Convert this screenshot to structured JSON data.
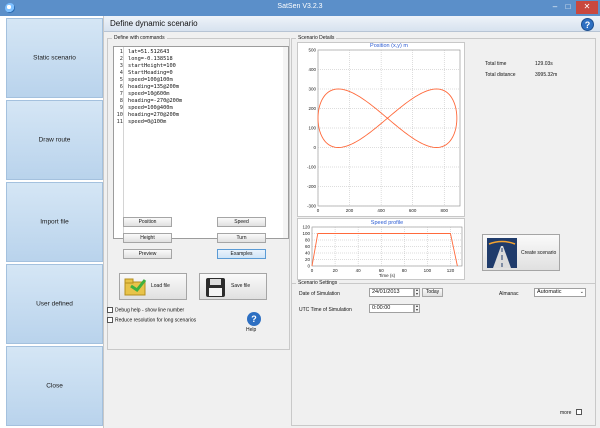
{
  "window": {
    "title": "SatSen V3.2.3",
    "minimize": "–",
    "maximize": "□",
    "close": "✕"
  },
  "sidebar": {
    "items": [
      {
        "label": "Static scenario"
      },
      {
        "label": "Draw route"
      },
      {
        "label": "Import file"
      },
      {
        "label": "User defined"
      },
      {
        "label": "Close"
      }
    ]
  },
  "header": {
    "title": "Define dynamic scenario",
    "help": "?"
  },
  "commands": {
    "group_label": "Define with commands",
    "lines": [
      {
        "n": "1",
        "code": "lat=51.512643"
      },
      {
        "n": "2",
        "code": "long=-0.138518"
      },
      {
        "n": "3",
        "code": "startHeight=100"
      },
      {
        "n": "4",
        "code": "StartHeading=0"
      },
      {
        "n": "5",
        "code": "speed=100@100m"
      },
      {
        "n": "6",
        "code": "heading=135@200m"
      },
      {
        "n": "7",
        "code": "speed=10@600m"
      },
      {
        "n": "8",
        "code": "heading=-270@200m"
      },
      {
        "n": "9",
        "code": "speed=100@400m"
      },
      {
        "n": "10",
        "code": "heading=270@200m"
      },
      {
        "n": "11",
        "code": "speed=0@100m"
      }
    ],
    "buttons": {
      "position": "Position",
      "speed": "Speed",
      "height": "Height",
      "turn": "Turn",
      "preview": "Preview",
      "examples": "Examples"
    },
    "load_file": "Load file",
    "save_file": "Save file",
    "debug_help": "Debug help - show line number",
    "reduce_resolution": "Reduce resolution for long scenarios",
    "help": "Help"
  },
  "details": {
    "group_label": "Scenario Details",
    "total_time_label": "Total time",
    "total_time_value": "129.03s",
    "total_distance_label": "Total distance",
    "total_distance_value": "3995.32m",
    "create_scenario": "Create scenario"
  },
  "settings": {
    "group_label": "Scenario Settings",
    "date_label": "Date of Simulation",
    "date_value": "24/01/2013",
    "today": "Today",
    "utc_label": "UTC Time of Simulation",
    "utc_value": "0:00:00",
    "almanac_label": "Almanac",
    "almanac_value": "Automatic",
    "more": "more"
  },
  "colors": {
    "trace": "#ff6a3c",
    "title_blue": "#2b5bd3",
    "titlebar": "#5b8fc9"
  },
  "chart_data": [
    {
      "type": "line",
      "title": "Position (x,y) m",
      "x_ticks": [
        "0",
        "200",
        "400",
        "600",
        "800"
      ],
      "y_ticks": [
        "500",
        "400",
        "300",
        "200",
        "100",
        "0",
        "-100",
        "-200",
        "-300"
      ],
      "xlim": [
        0,
        900
      ],
      "ylim": [
        -300,
        500
      ],
      "grid": true,
      "shape": "figure-eight",
      "x_amplitude": 440,
      "x_center": 440,
      "y_amplitude": 150,
      "y_center": 150
    },
    {
      "type": "line",
      "title": "Speed profile",
      "xlabel": "Time (s)",
      "x_ticks": [
        "0",
        "20",
        "40",
        "60",
        "80",
        "100",
        "120"
      ],
      "y_ticks": [
        "120",
        "100",
        "80",
        "60",
        "40",
        "20",
        "0"
      ],
      "xlim": [
        0,
        130
      ],
      "ylim": [
        0,
        120
      ],
      "grid": true,
      "x": [
        0,
        5,
        120,
        126
      ],
      "y": [
        0,
        100,
        100,
        0
      ]
    }
  ]
}
